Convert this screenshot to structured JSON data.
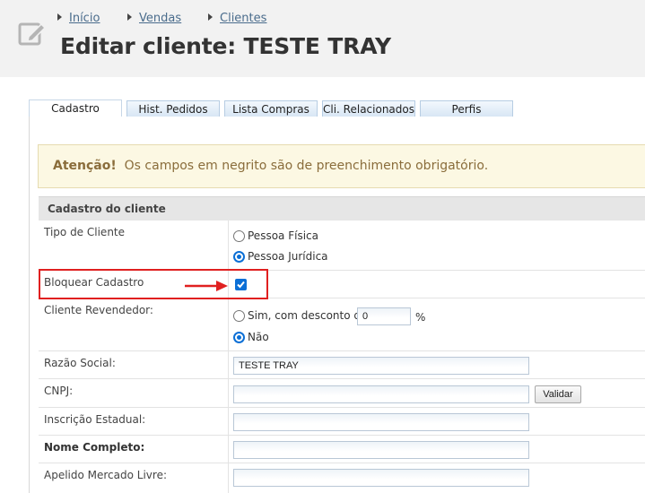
{
  "breadcrumb": [
    "Início",
    "Vendas",
    "Clientes"
  ],
  "page_title": "Editar cliente: TESTE TRAY",
  "tabs": [
    {
      "label": "Cadastro",
      "active": true
    },
    {
      "label": "Hist. Pedidos",
      "active": false
    },
    {
      "label": "Lista Compras",
      "active": false
    },
    {
      "label": "Cli. Relacionados",
      "active": false
    },
    {
      "label": "Perfis",
      "active": false
    }
  ],
  "alert": {
    "title": "Atenção!",
    "message": "Os campos em negrito são de preenchimento obrigatório."
  },
  "section_title": "Cadastro do cliente",
  "form": {
    "tipo_cliente": {
      "label": "Tipo de Cliente",
      "options": [
        {
          "label": "Pessoa Física",
          "checked": false
        },
        {
          "label": "Pessoa Jurídica",
          "checked": true
        }
      ]
    },
    "bloquear_cadastro": {
      "label": "Bloquear Cadastro",
      "checked": true
    },
    "cliente_revendedor": {
      "label": "Cliente Revendedor:",
      "option_sim": "Sim, com desconto de",
      "discount_value": "0",
      "percent": "%",
      "option_nao": "Não",
      "selected": "Não"
    },
    "razao_social": {
      "label": "Razão Social:",
      "value": "TESTE TRAY"
    },
    "cnpj": {
      "label": "CNPJ:",
      "value": "",
      "button": "Validar"
    },
    "inscricao_estadual": {
      "label": "Inscrição Estadual:",
      "value": ""
    },
    "nome_completo": {
      "label": "Nome Completo:",
      "value": ""
    },
    "apelido": {
      "label": "Apelido Mercado Livre:",
      "value": ""
    }
  },
  "colors": {
    "accent": "#0b6fd6",
    "highlight": "#e02020",
    "alert_bg": "#fcf8e3",
    "alert_text": "#8a6d3b"
  }
}
